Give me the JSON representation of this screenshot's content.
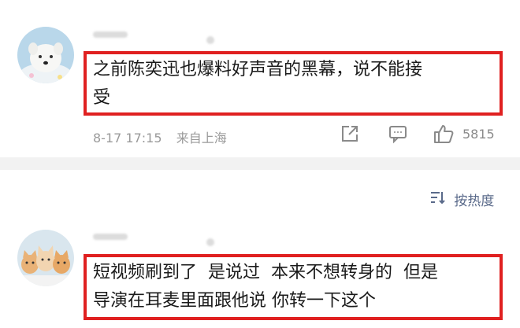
{
  "comments": [
    {
      "username_blurred": "",
      "text_line1": "之前陈奕迅也爆料好声音的黑幕，说不能接",
      "text_line2": "受",
      "timestamp": "8-17 17:15",
      "location": "来自上海",
      "like_count": "5815"
    },
    {
      "username_blurred": "",
      "text_line1": "短视频刷到了  是说过  本来不想转身的  但是",
      "text_line2": "导演在耳麦里面跟他说 你转一下这个"
    }
  ],
  "sort": {
    "label": "按热度"
  },
  "colors": {
    "highlight_border": "#e02020",
    "divider": "#f2f2f2",
    "meta_text": "#9a9a9a"
  }
}
